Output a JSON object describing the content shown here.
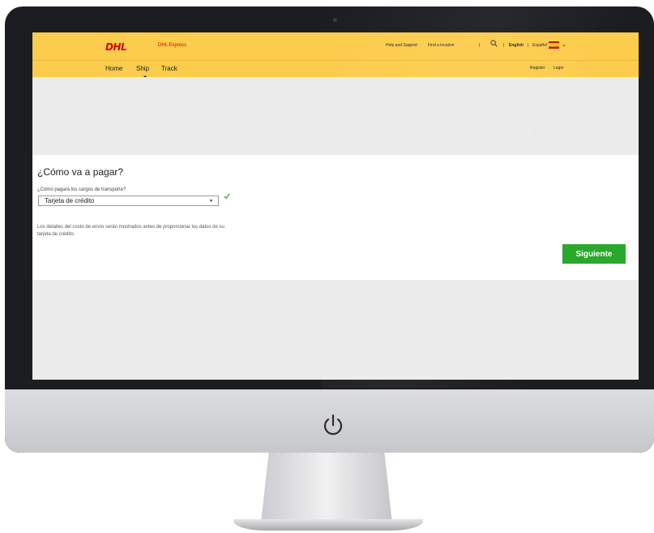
{
  "header": {
    "logo_text": "DHL",
    "logo_subtitle": "DHL Express",
    "help_support": "Help and Support",
    "find_location": "Find a location",
    "separator": "|",
    "lang_english": "English",
    "lang_spanish": "Español",
    "flag_icon": "spain-flag-icon"
  },
  "nav": {
    "items": [
      {
        "label": "Home"
      },
      {
        "label": "Ship"
      },
      {
        "label": "Track"
      }
    ],
    "register": "Register",
    "login": "Login",
    "active": "Ship"
  },
  "form": {
    "title": "¿Cómo va a pagar?",
    "field_label": "¿Cómo pagará los cargos de transporte?",
    "selected_value": "Tarjeta de crédito",
    "help_text": "Los detalles del costo de envío serán mostrados antes de proporcionar los datos de su tarjeta de crédito.",
    "next_button": "Siguiente"
  },
  "colors": {
    "brand_yellow": "#fccc4c",
    "brand_red": "#d40511",
    "button_green": "#29a829",
    "check_green": "#3aa83a"
  }
}
